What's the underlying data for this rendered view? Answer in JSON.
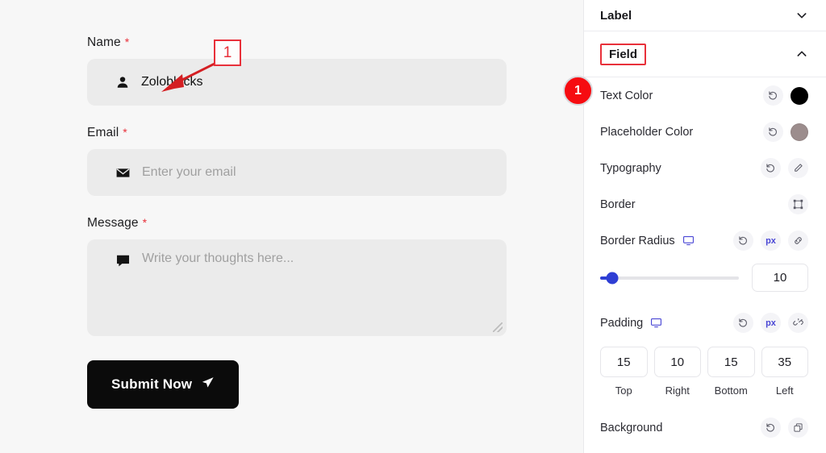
{
  "form": {
    "fields": [
      {
        "label": "Name",
        "required": "*",
        "icon": "user-icon",
        "value": "Zoloblocks",
        "placeholder": ""
      },
      {
        "label": "Email",
        "required": "*",
        "icon": "mail-icon",
        "value": "",
        "placeholder": "Enter your email"
      },
      {
        "label": "Message",
        "required": "*",
        "icon": "comment-icon",
        "value": "",
        "placeholder": "Write your thoughts here..."
      }
    ],
    "submit_label": "Submit Now",
    "submit_icon": "send-icon"
  },
  "panel": {
    "sections": [
      {
        "title": "Label",
        "collapsed": true,
        "chevron": "chevron-down-icon"
      },
      {
        "title": "Field",
        "collapsed": false,
        "chevron": "chevron-up-icon"
      }
    ],
    "rows": {
      "text_color": {
        "label": "Text Color",
        "reset_icon": "reset-icon",
        "swatch": "#000000"
      },
      "placeholder_color": {
        "label": "Placeholder Color",
        "reset_icon": "reset-icon",
        "swatch": "#9c8d8d"
      },
      "typography": {
        "label": "Typography",
        "reset_icon": "reset-icon",
        "edit_icon": "pencil-icon"
      },
      "border": {
        "label": "Border",
        "border_icon": "border-box-icon"
      },
      "border_radius": {
        "label": "Border Radius",
        "device_icon": "desktop-icon",
        "reset_icon": "reset-icon",
        "unit": "px",
        "link_icon": "link-icon",
        "value": "10",
        "slider_percent": 9
      },
      "padding": {
        "label": "Padding",
        "device_icon": "desktop-icon",
        "reset_icon": "reset-icon",
        "unit": "px",
        "link_icon": "unlink-icon",
        "values": [
          {
            "value": "15",
            "name": "Top"
          },
          {
            "value": "10",
            "name": "Right"
          },
          {
            "value": "15",
            "name": "Bottom"
          },
          {
            "value": "35",
            "name": "Left"
          }
        ]
      },
      "background": {
        "label": "Background",
        "reset_icon": "reset-icon",
        "copy_icon": "layers-icon"
      }
    }
  },
  "annotations": {
    "square_badge": "1",
    "circle_badge": "1",
    "accent": "#e8303a",
    "circle_color": "#f60c11"
  }
}
